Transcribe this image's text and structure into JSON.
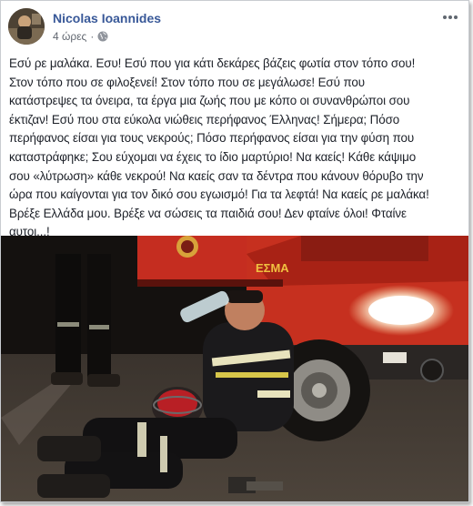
{
  "post": {
    "author": "Nicolas Ioannides",
    "time": "4 ώρες",
    "separator": "·",
    "privacy_icon": "globe-icon",
    "more_icon": "ellipsis-icon",
    "text": "Εσύ ρε μαλάκα. Εσυ! Εσύ που για κάτι δεκάρες βάζεις φωτία στον τόπο σου!\nΣτον τόπο που σε φιλοξενεί! Στον τόπο που σε μεγάλωσε! Εσύ που\nκατάστρεψες τα όνειρα, τα έργα μια ζωής που με κόπο οι συνανθρώποι σου\nέκτιζαν! Εσύ που στα εύκολα νιώθεις περήφανος Έλληνας! Σήμερα; Πόσο\nπερήφανος είσαι για τους νεκρούς; Πόσο περήφανος είσαι για την φύση που\nκαταστράφηκε; Σου εύχομαι να έχεις το ίδιο μαρτύριο! Να καείς! Κάθε κάψιμο\nσου «λύτρωση» κάθε νεκρού! Να καείς σαν τα δέντρα που κάνουν θόρυβο την\nώρα που καίγονται για τον δικό σου εγωισμό! Για τα λεφτά! Να καείς ρε μαλάκα!\nΒρέξε Ελλάδα μου. Βρέξε να σώσεις τα παιδιά σου! Δεν φταίνε όλοι! Φταίνε\nαυτοι...!"
  },
  "photo": {
    "truck_label": "ΕΣΜΑ"
  },
  "colors": {
    "author_link": "#385898",
    "meta_text": "#616770",
    "body_text": "#1d2129",
    "truck_red": "#c0281b"
  }
}
